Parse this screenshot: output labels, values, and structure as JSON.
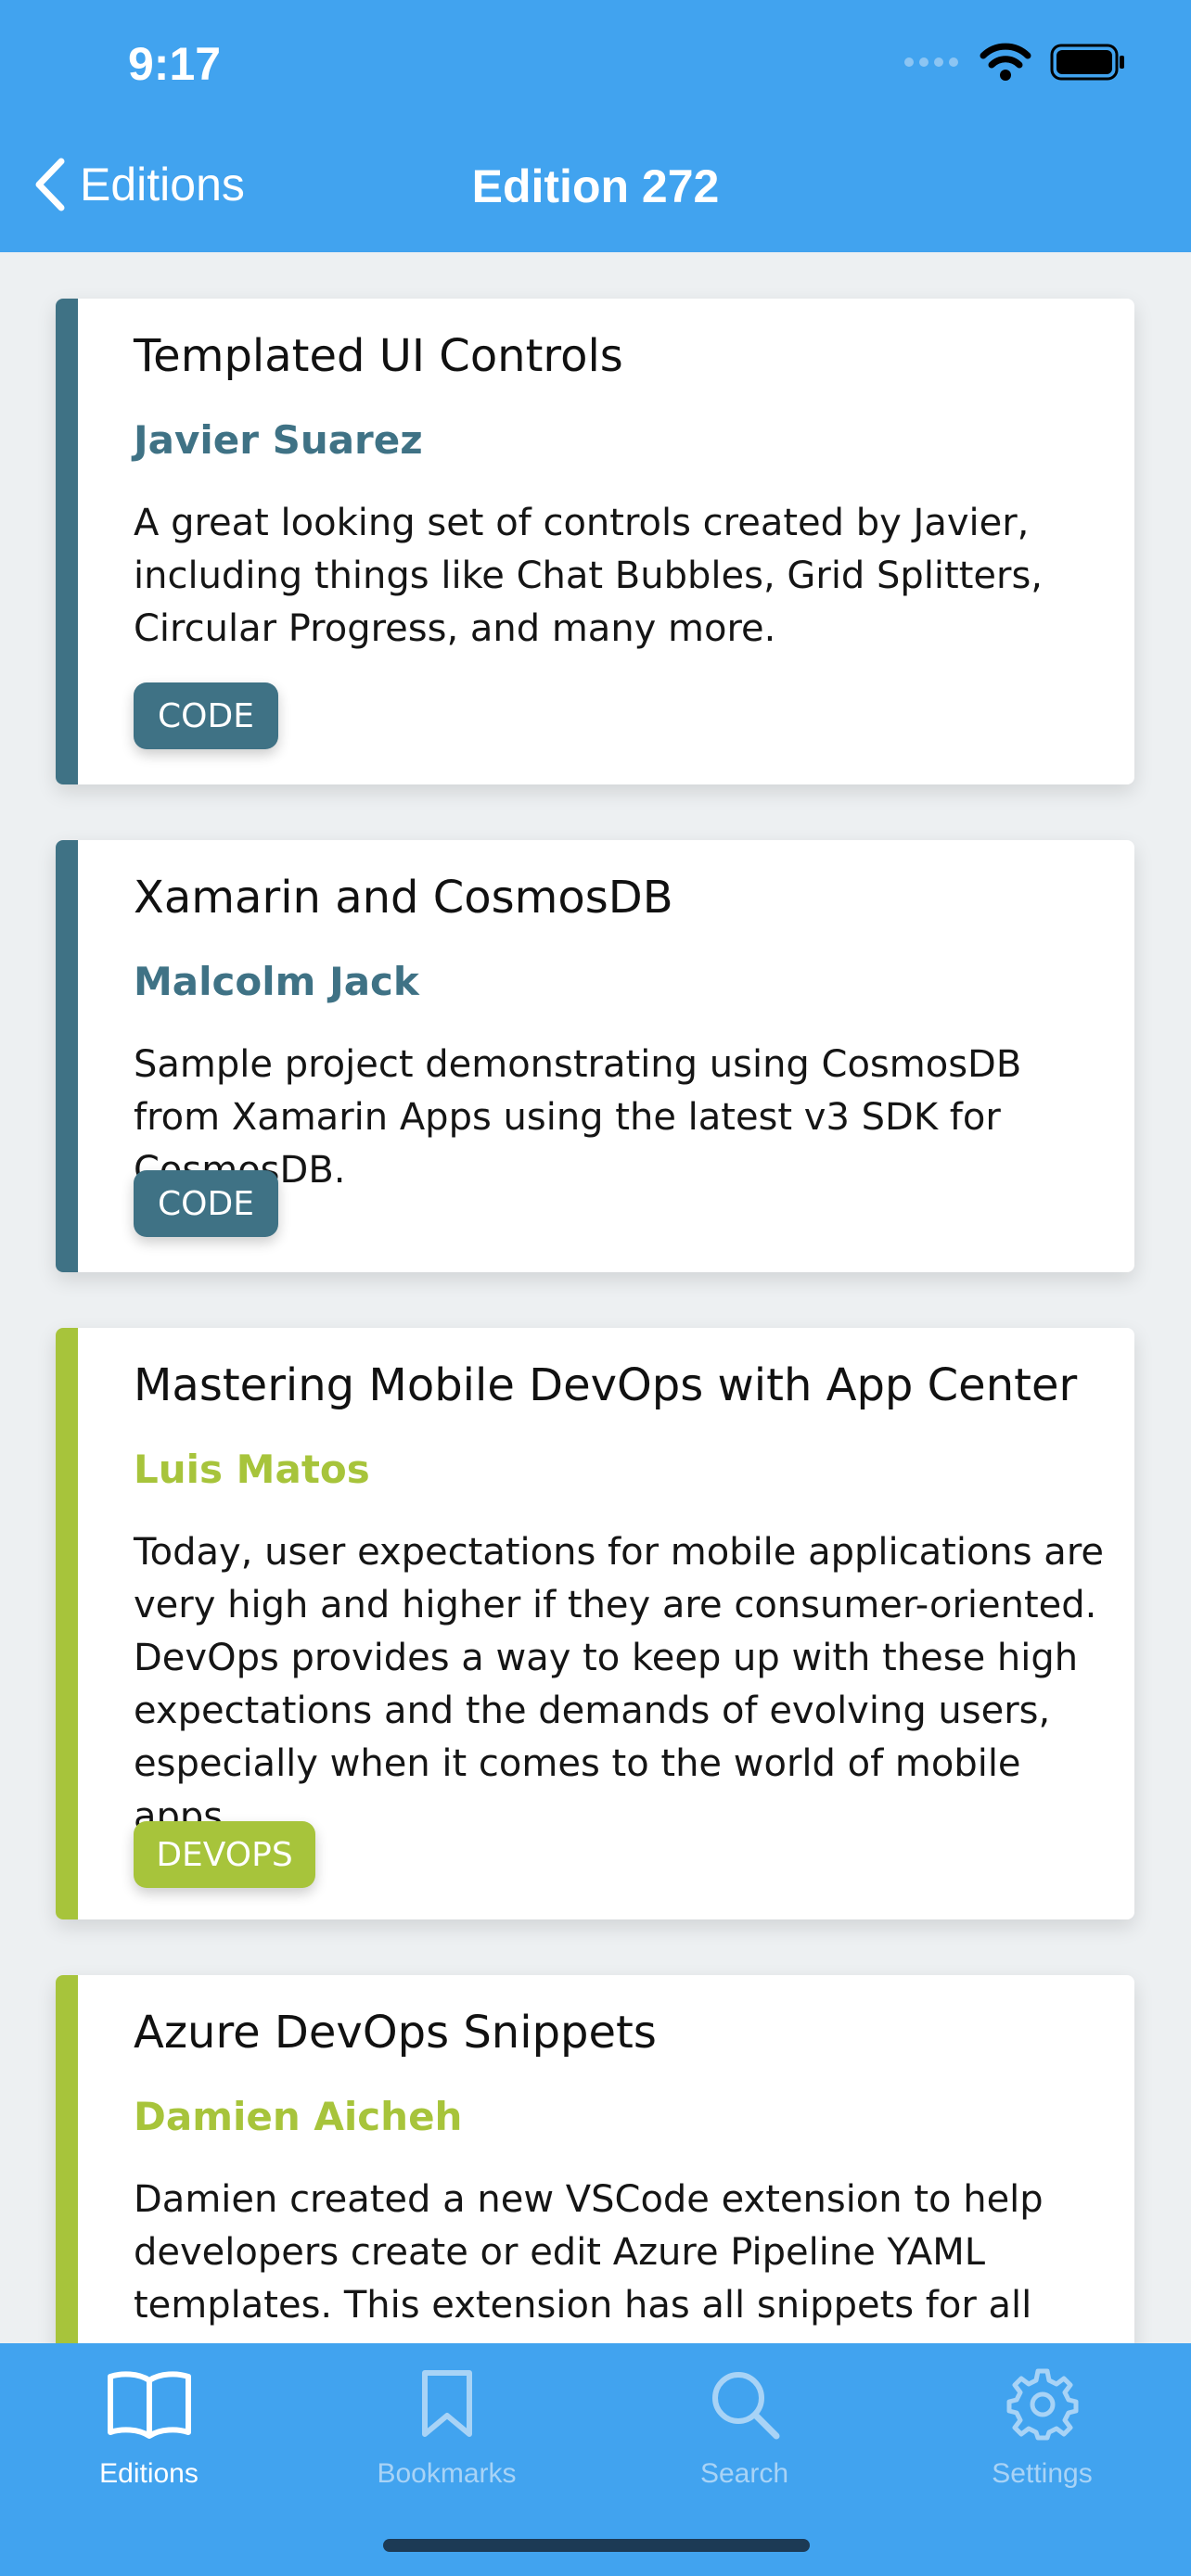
{
  "status_bar": {
    "time": "9:17"
  },
  "nav": {
    "back_label": "Editions",
    "title": "Edition 272"
  },
  "colors": {
    "header": "#41a3ef",
    "code_accent": "#3f7285",
    "devops_accent": "#a7c43b"
  },
  "articles": [
    {
      "title": "Templated UI Controls",
      "author": "Javier Suarez",
      "description": "A great looking set of controls created by Javier, including things like Chat Bubbles, Grid Splitters, Circular Progress, and many more.",
      "tag": "CODE"
    },
    {
      "title": "Xamarin and CosmosDB",
      "author": "Malcolm Jack",
      "description": "Sample project demonstrating using CosmosDB from Xamarin Apps using the latest v3 SDK for CosmosDB.",
      "tag": "CODE"
    },
    {
      "title": "Mastering Mobile DevOps with App Center",
      "author": "Luis Matos",
      "description": "Today, user expectations for mobile applications are very high and higher if they are consumer-oriented. DevOps provides a way to keep up with these high expectations and the demands of evolving users, especially when it comes to the world of mobile apps.",
      "tag": "DEVOPS"
    },
    {
      "title": "Azure DevOps Snippets",
      "author": "Damien Aicheh",
      "description": "Damien created a new VSCode extension to help developers create or edit Azure Pipeline YAML templates. This extension has all snippets for all",
      "tag": ""
    }
  ],
  "tabs": [
    {
      "label": "Editions",
      "icon": "book-icon",
      "active": true
    },
    {
      "label": "Bookmarks",
      "icon": "bookmark-icon",
      "active": false
    },
    {
      "label": "Search",
      "icon": "search-icon",
      "active": false
    },
    {
      "label": "Settings",
      "icon": "gear-icon",
      "active": false
    }
  ]
}
